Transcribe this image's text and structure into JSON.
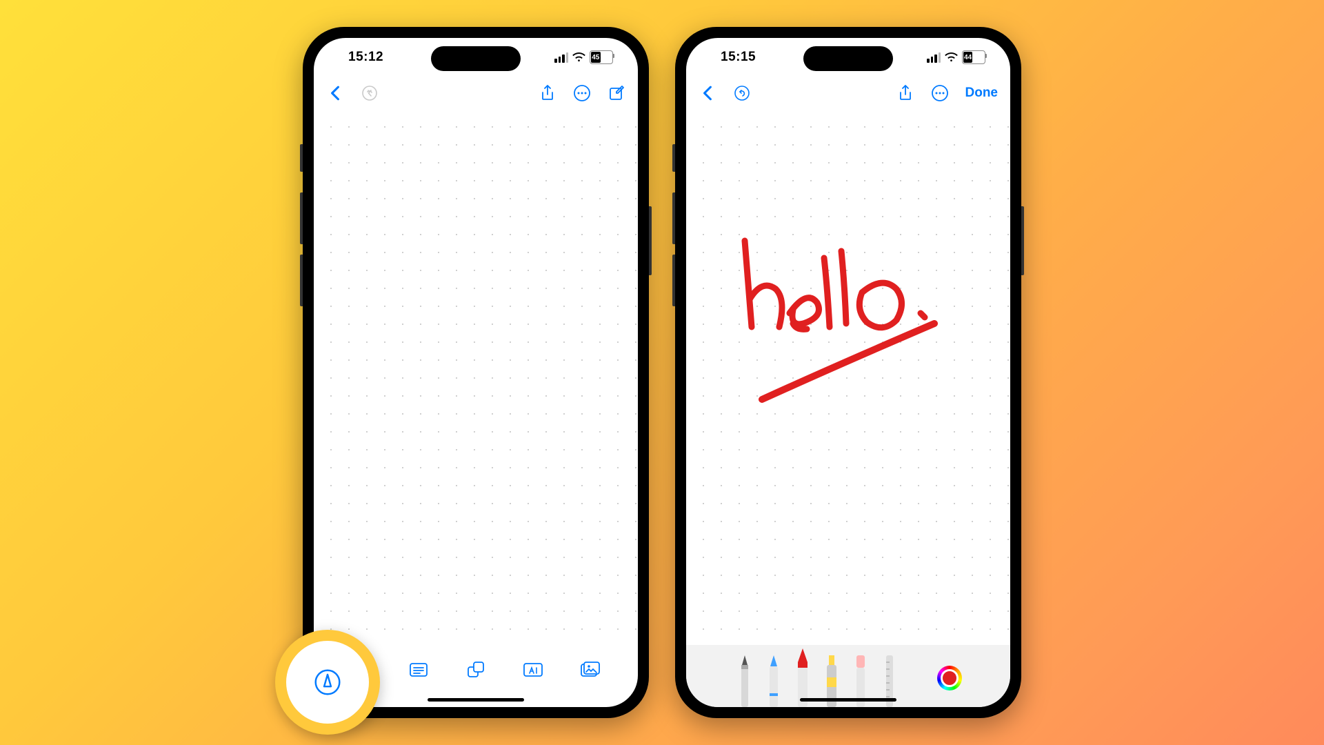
{
  "accent": "#007aff",
  "ink_color": "#e02020",
  "handwritten_text": "hello.",
  "phone_left": {
    "status": {
      "time": "15:12",
      "battery_pct": "45"
    },
    "nav": {
      "undo_enabled": false,
      "actions": [
        "share",
        "more",
        "compose"
      ]
    },
    "toolbar": [
      "markup",
      "text-box",
      "shapes",
      "text-format",
      "media"
    ],
    "highlighted_tool": "markup"
  },
  "phone_right": {
    "status": {
      "time": "15:15",
      "battery_pct": "44"
    },
    "nav": {
      "undo_enabled": true,
      "actions": [
        "share",
        "more"
      ],
      "done_label": "Done"
    },
    "palette": {
      "tools": [
        "pen",
        "pencil",
        "crayon",
        "highlighter",
        "eraser",
        "ruler"
      ],
      "selected": "crayon",
      "current_color": "#e02020"
    }
  }
}
